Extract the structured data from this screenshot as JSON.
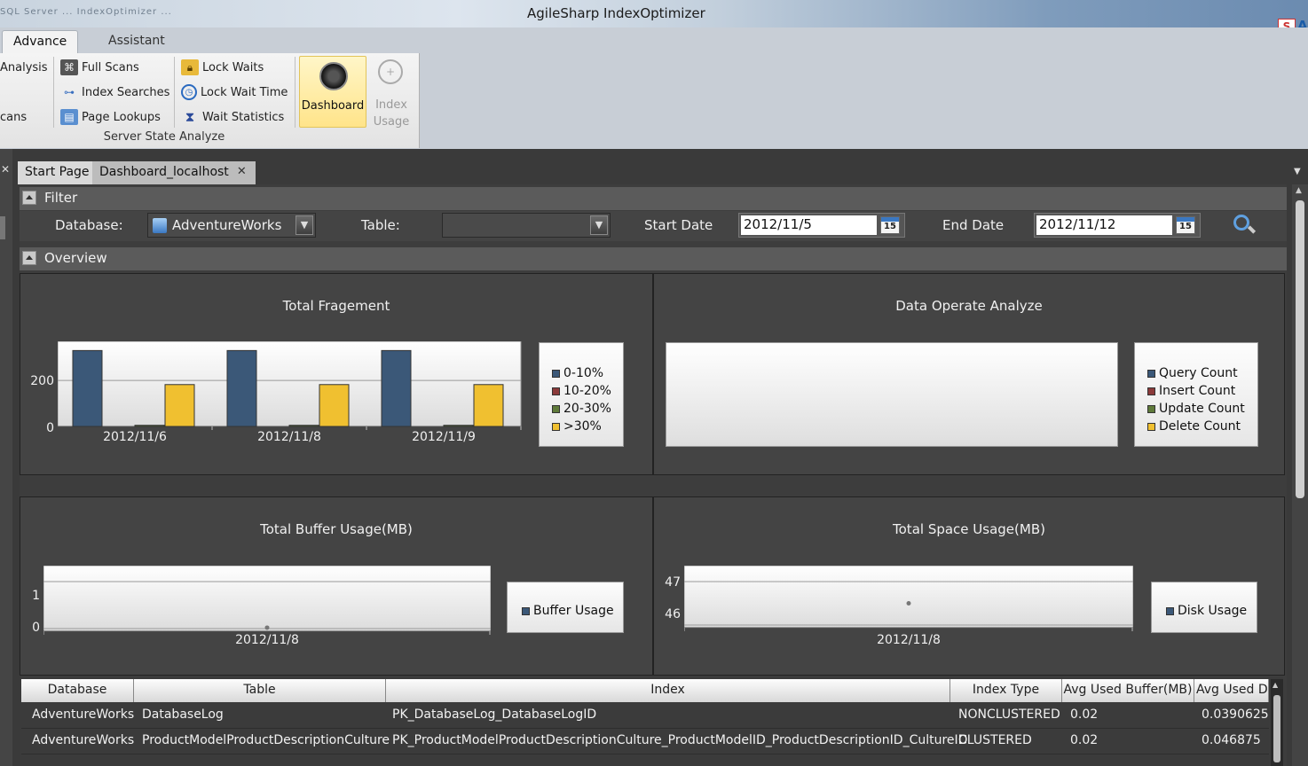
{
  "window": {
    "title": "AgileSharp IndexOptimizer",
    "blurred_prefix": "SQL Server ... IndexOptimizer ..."
  },
  "ribbon_tabs": [
    "Advance",
    "Assistant"
  ],
  "ribbon": {
    "col1": [
      "Analysis",
      "cans"
    ],
    "col2": [
      {
        "label": "Full Scans",
        "icon": "binoculars-icon"
      },
      {
        "label": "Index Searches",
        "icon": "tree-icon"
      },
      {
        "label": "Page Lookups",
        "icon": "book-icon"
      }
    ],
    "col3": [
      {
        "label": "Lock Waits",
        "icon": "lock-icon"
      },
      {
        "label": "Lock Wait Time",
        "icon": "alarm-clock-icon"
      },
      {
        "label": "Wait Statistics",
        "icon": "hourglass-icon"
      }
    ],
    "dashboard_label": "Dashboard",
    "index_usage_label": [
      "Index",
      "Usage"
    ],
    "group_label": "Server State Analyze"
  },
  "doc_tabs": [
    "Start Page",
    "Dashboard_localhost"
  ],
  "filter": {
    "header": "Filter",
    "database_label": "Database:",
    "database_value": "AdventureWorks",
    "table_label": "Table:",
    "table_value": "",
    "start_label": "Start Date",
    "start_value": "2012/11/5",
    "end_label": "End Date",
    "end_value": "2012/11/12",
    "calendar_day": "15"
  },
  "overview": {
    "header": "Overview"
  },
  "charts": {
    "fragment": {
      "title": "Total Fragement",
      "legend": [
        "0-10%",
        "10-20%",
        "20-30%",
        ">30%"
      ]
    },
    "operate": {
      "title": "Data Operate Analyze",
      "legend": [
        "Query Count",
        "Insert Count",
        "Update Count",
        "Delete Count"
      ]
    },
    "buffer": {
      "title": "Total Buffer Usage(MB)",
      "legend": [
        "Buffer Usage"
      ],
      "yticks": [
        "1",
        "0"
      ],
      "xtick": "2012/11/8"
    },
    "space": {
      "title": "Total Space Usage(MB)",
      "legend": [
        "Disk Usage"
      ],
      "yticks": [
        "47",
        "46"
      ],
      "xtick": "2012/11/8"
    }
  },
  "chart_data": [
    {
      "type": "bar",
      "title": "Total Fragement",
      "categories": [
        "2012/11/6",
        "2012/11/8",
        "2012/11/9"
      ],
      "series": [
        {
          "name": "0-10%",
          "values": [
            330,
            330,
            330
          ]
        },
        {
          "name": "10-20%",
          "values": [
            0,
            0,
            0
          ]
        },
        {
          "name": "20-30%",
          "values": [
            5,
            5,
            5
          ]
        },
        {
          "name": ">30%",
          "values": [
            182,
            182,
            182
          ]
        }
      ],
      "ylim": [
        0,
        370
      ],
      "yticks": [
        0,
        200
      ],
      "colors": [
        "#3b5878",
        "#8b3a3a",
        "#5f7a3a",
        "#f0c030"
      ],
      "legend": "right"
    },
    {
      "type": "bar",
      "title": "Data Operate Analyze",
      "categories": [],
      "series": [
        {
          "name": "Query Count",
          "values": []
        },
        {
          "name": "Insert Count",
          "values": []
        },
        {
          "name": "Update Count",
          "values": []
        },
        {
          "name": "Delete Count",
          "values": []
        }
      ],
      "legend": "right"
    },
    {
      "type": "line",
      "title": "Total Buffer Usage(MB)",
      "x": [
        "2012/11/8"
      ],
      "series": [
        {
          "name": "Buffer Usage",
          "values": [
            0.02
          ]
        }
      ],
      "ylim": [
        0,
        1
      ],
      "yticks": [
        0,
        1
      ],
      "legend": "right"
    },
    {
      "type": "line",
      "title": "Total Space Usage(MB)",
      "x": [
        "2012/11/8"
      ],
      "series": [
        {
          "name": "Disk Usage",
          "values": [
            46.5
          ]
        }
      ],
      "ylim": [
        46,
        47
      ],
      "yticks": [
        46,
        47
      ],
      "legend": "right"
    }
  ],
  "grid": {
    "columns": [
      "Database",
      "Table",
      "Index",
      "Index Type",
      "Avg Used Buffer(MB)",
      "Avg Used D"
    ],
    "rows": [
      [
        "AdventureWorks",
        "DatabaseLog",
        "PK_DatabaseLog_DatabaseLogID",
        "NONCLUSTERED",
        "0.02",
        "0.0390625"
      ],
      [
        "AdventureWorks",
        "ProductModelProductDescriptionCulture",
        "PK_ProductModelProductDescriptionCulture_ProductModelID_ProductDescriptionID_CultureID",
        "CLUSTERED",
        "0.02",
        "0.046875"
      ]
    ]
  }
}
